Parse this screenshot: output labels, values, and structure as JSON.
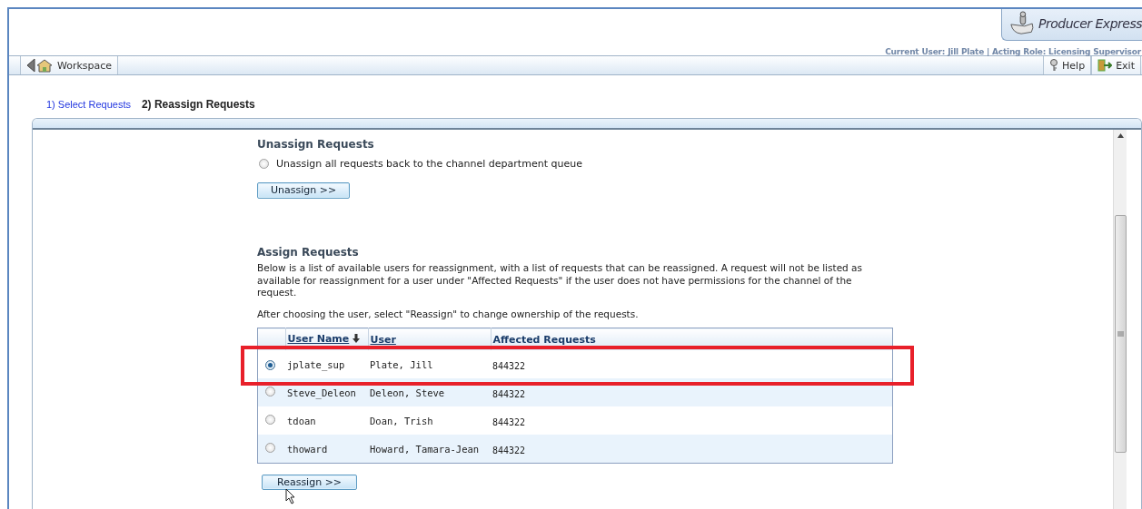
{
  "header": {
    "product": "Producer Express",
    "session": "Current User: Jill Plate | Acting Role: Licensing Supervisor"
  },
  "toolbar": {
    "back": "Workspace",
    "help": "Help",
    "exit": "Exit"
  },
  "steps": [
    {
      "label": "1) Select Requests",
      "selected": false
    },
    {
      "label": "2) Reassign Requests",
      "selected": true
    }
  ],
  "unassign": {
    "heading": "Unassign Requests",
    "option": {
      "label": "Unassign all requests back to the channel department queue",
      "selected": false
    },
    "button": "Unassign >>"
  },
  "assign": {
    "heading": "Assign Requests",
    "description": "Below is a list of available users for reassignment, with a list of requests that can be reassigned. A request will not be listed as available for reassignment for a user under \"Affected Requests\" if the user does not have permissions for the channel of the request.",
    "instruction": "After choosing the user, select \"Reassign\" to change ownership of the requests.",
    "columns": [
      {
        "label": "User Name",
        "sortable": true,
        "sorted": true
      },
      {
        "label": "User",
        "sortable": true,
        "sorted": false
      },
      {
        "label": "Affected Requests",
        "sortable": false,
        "sorted": false
      }
    ],
    "rows": [
      {
        "selected": true,
        "highlighted": true,
        "user_name": "jplate_sup",
        "user": "Plate, Jill",
        "affected_requests": "844322"
      },
      {
        "selected": false,
        "highlighted": false,
        "user_name": "Steve_Deleon",
        "user": "Deleon, Steve",
        "affected_requests": "844322"
      },
      {
        "selected": false,
        "highlighted": false,
        "user_name": "tdoan",
        "user": "Doan, Trish",
        "affected_requests": "844322"
      },
      {
        "selected": false,
        "highlighted": false,
        "user_name": "thoward",
        "user": "Howard, Tamara-Jean",
        "affected_requests": "844322"
      }
    ],
    "button": "Reassign >>"
  }
}
